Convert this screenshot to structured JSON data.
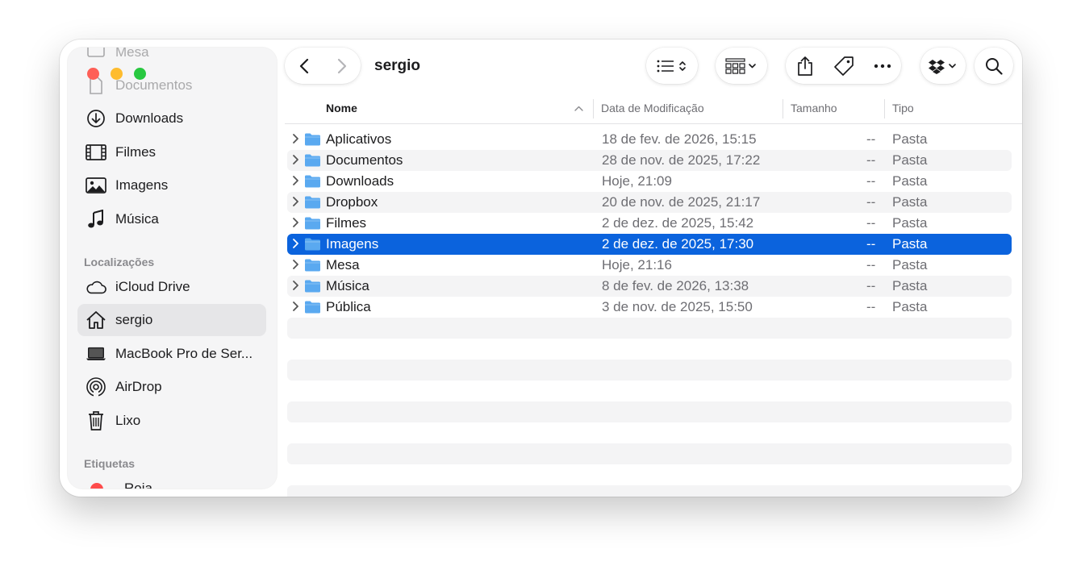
{
  "window": {
    "title": "sergio"
  },
  "sidebar": {
    "top_faded": [
      "Mesa",
      "Documentos"
    ],
    "favorites": [
      {
        "label": "Downloads",
        "icon": "download-circle-icon"
      },
      {
        "label": "Filmes",
        "icon": "film-icon"
      },
      {
        "label": "Imagens",
        "icon": "photo-icon"
      },
      {
        "label": "Música",
        "icon": "music-note-icon"
      }
    ],
    "locations_header": "Localizações",
    "locations": [
      {
        "label": "iCloud Drive",
        "icon": "cloud-icon"
      },
      {
        "label": "sergio",
        "icon": "home-icon",
        "selected": true
      },
      {
        "label": "MacBook Pro de Ser...",
        "icon": "laptop-icon"
      },
      {
        "label": "AirDrop",
        "icon": "airdrop-icon"
      },
      {
        "label": "Lixo",
        "icon": "trash-icon"
      }
    ],
    "tags_header": "Etiquetas",
    "tags": [
      {
        "label": "Roja",
        "color": "#fe4b4b"
      }
    ]
  },
  "columns": {
    "name": "Nome",
    "date": "Data de Modificação",
    "size": "Tamanho",
    "kind": "Tipo"
  },
  "files": [
    {
      "name": "Aplicativos",
      "date": "18 de fev. de 2026, 15:15",
      "size": "--",
      "kind": "Pasta"
    },
    {
      "name": "Documentos",
      "date": "28 de nov. de 2025, 17:22",
      "size": "--",
      "kind": "Pasta"
    },
    {
      "name": "Downloads",
      "date": "Hoje, 21:09",
      "size": "--",
      "kind": "Pasta"
    },
    {
      "name": "Dropbox",
      "date": "20 de nov. de 2025, 21:17",
      "size": "--",
      "kind": "Pasta"
    },
    {
      "name": "Filmes",
      "date": "2 de dez. de 2025, 15:42",
      "size": "--",
      "kind": "Pasta"
    },
    {
      "name": "Imagens",
      "date": "2 de dez. de 2025, 17:30",
      "size": "--",
      "kind": "Pasta",
      "selected": true
    },
    {
      "name": "Mesa",
      "date": "Hoje, 21:16",
      "size": "--",
      "kind": "Pasta"
    },
    {
      "name": "Música",
      "date": "8 de fev. de 2026, 13:38",
      "size": "--",
      "kind": "Pasta"
    },
    {
      "name": "Pública",
      "date": "3 de nov. de 2025, 15:50",
      "size": "--",
      "kind": "Pasta"
    }
  ],
  "colors": {
    "accent": "#0b63dd",
    "folder": "#5aa9f0",
    "close": "#fe5f57",
    "minimize": "#febc2e",
    "zoom": "#28c840"
  }
}
